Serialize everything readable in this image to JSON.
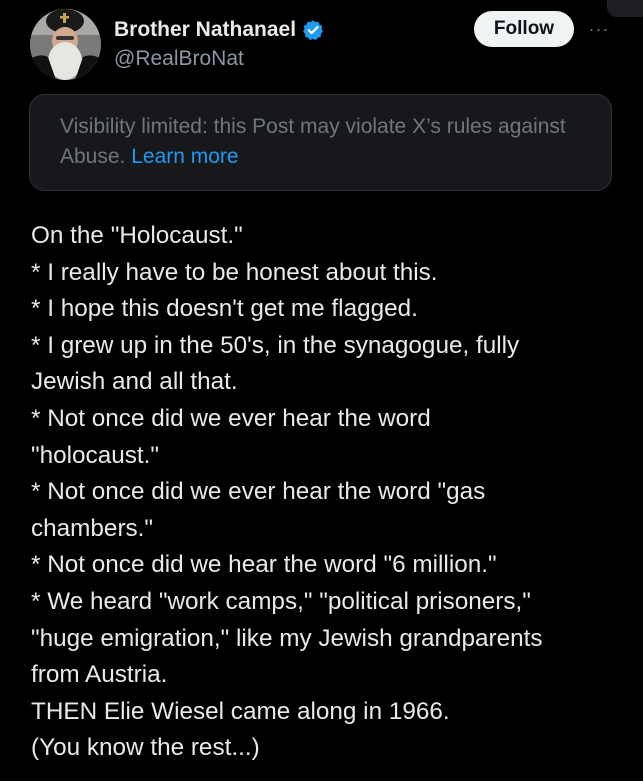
{
  "author": {
    "display_name": "Brother Nathanael",
    "handle": "@RealBroNat",
    "verified_icon": "verified-badge-icon",
    "avatar": "profile-photo"
  },
  "actions": {
    "follow_label": "Follow",
    "more_icon": "more-horizontal-icon",
    "more_glyph": "···"
  },
  "notice": {
    "text": "Visibility limited: this Post may violate X’s rules against Abuse. ",
    "link": "Learn more"
  },
  "post": {
    "lines": [
      "On the \"Holocaust.\"",
      "* I really have to be honest about this.",
      "* I hope this doesn't get me flagged.",
      "* I grew up in the 50's, in the synagogue, fully",
      "Jewish and all that.",
      "* Not once did we ever hear the word",
      "\"holocaust.\"",
      "* Not once did we ever hear the word \"gas",
      "chambers.\"",
      "* Not once did we hear the word \"6 million.\"",
      "* We heard \"work camps,\" \"political prisoners,\"",
      "\"huge emigration,\" like my Jewish grandparents",
      "from Austria.",
      "THEN Elie Wiesel came along in 1966.",
      "(You know the rest...)"
    ]
  },
  "colors": {
    "background": "#000000",
    "text": "#e7e9ea",
    "secondary_text": "#8b98a5",
    "link": "#1d9bf0",
    "verified": "#1d9bf0",
    "notice_background": "#16181c",
    "follow_button": "#eff3f4"
  }
}
